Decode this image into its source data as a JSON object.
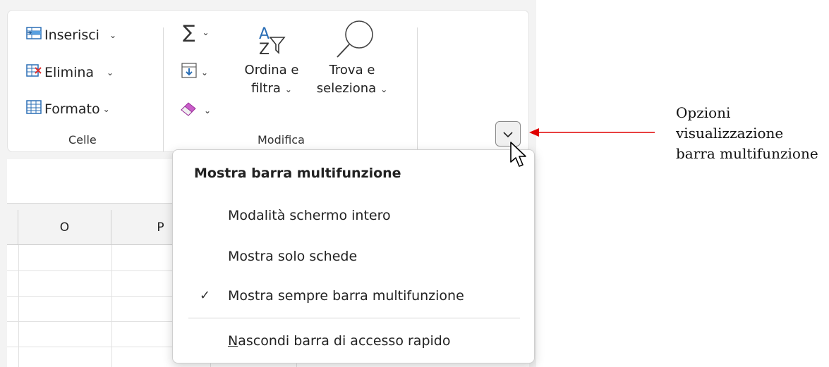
{
  "ribbon": {
    "celle": {
      "group_label": "Celle",
      "inserisci": "Inserisci",
      "elimina": "Elimina",
      "formato": "Formato"
    },
    "modifica": {
      "group_label": "Modifica",
      "sort_filter_line1": "Ordina e",
      "sort_filter_line2": "filtra",
      "find_select_line1": "Trova e",
      "find_select_line2": "seleziona"
    }
  },
  "sheet": {
    "columns": [
      "O",
      "P"
    ]
  },
  "menu": {
    "title": "Mostra barra multifunzione",
    "items": [
      {
        "label": "Modalità schermo intero",
        "checked": false
      },
      {
        "label": "Mostra solo schede",
        "checked": false
      },
      {
        "label": "Mostra sempre barra multifunzione",
        "checked": true
      }
    ],
    "footer_mnemonic": "N",
    "footer_rest": "ascondi barra di accesso rapido"
  },
  "callout": {
    "line1": "Opzioni",
    "line2": "visualizzazione",
    "line3": "barra multifunzione",
    "arrow_color": "#e00000"
  },
  "icons": [
    "insert-cells-icon",
    "delete-cells-icon",
    "format-cells-icon",
    "autosum-icon",
    "fill-icon",
    "clear-icon",
    "sort-filter-icon",
    "find-icon",
    "chevron-down-icon",
    "check-icon",
    "mouse-cursor-icon"
  ]
}
